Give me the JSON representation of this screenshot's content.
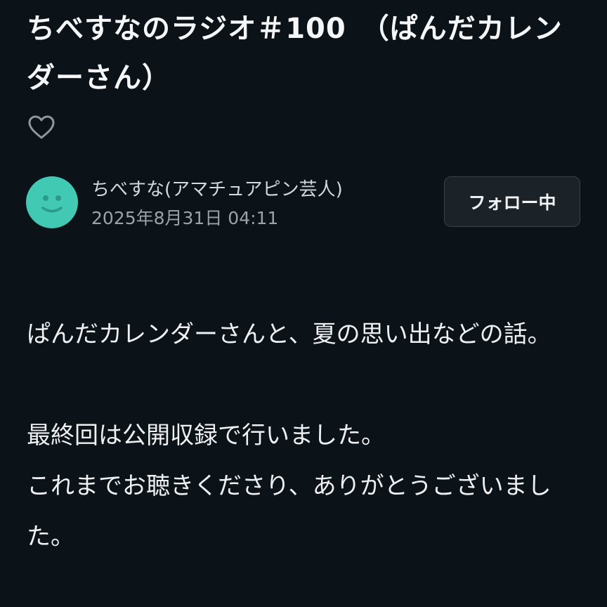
{
  "article": {
    "title": "ちべすなのラジオ＃100　（ぱんだカレンダーさん）",
    "like_icon": "heart-outline-icon"
  },
  "author": {
    "name": "ちべすな(アマチュアピン芸人)",
    "date": "2025年8月31日 04:11",
    "avatar_icon": "smiley-face-icon",
    "avatar_color": "#41c9b4"
  },
  "follow_button": {
    "label": "フォロー中"
  },
  "body": {
    "paragraphs": [
      "ぱんだカレンダーさんと、夏の思い出などの話。",
      "最終回は公開収録で行いました。\nこれまでお聴きくださり、ありがとうございました。"
    ]
  },
  "colors": {
    "background": "#0b1218",
    "text": "#f2f4f5",
    "muted": "#9aa3aa"
  }
}
